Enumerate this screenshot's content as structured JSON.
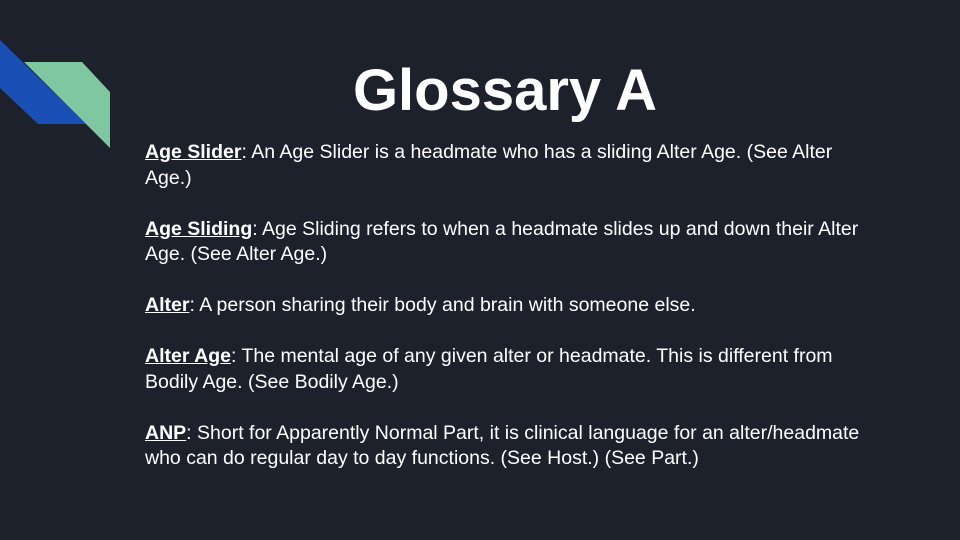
{
  "slide": {
    "title": "Glossary A",
    "accent_colors": {
      "background": "#1c212c",
      "blue": "#1a4fb5",
      "green": "#7fc7a0"
    },
    "entries": [
      {
        "term": "Age Slider",
        "definition": ": An Age Slider is a headmate who has a sliding Alter Age. (See Alter Age.)"
      },
      {
        "term": "Age Sliding",
        "definition": ": Age Sliding refers to when a headmate slides up and down their Alter Age. (See Alter Age.)"
      },
      {
        "term": "Alter",
        "definition": ": A person sharing their body and brain with someone else."
      },
      {
        "term": "Alter Age",
        "definition": ": The mental age of any given alter or headmate. This is different from Bodily Age. (See Bodily Age.)"
      },
      {
        "term": "ANP",
        "definition": ": Short for Apparently Normal Part, it is clinical language for an alter/headmate who can do regular day to day functions. (See Host.) (See Part.)"
      }
    ]
  }
}
